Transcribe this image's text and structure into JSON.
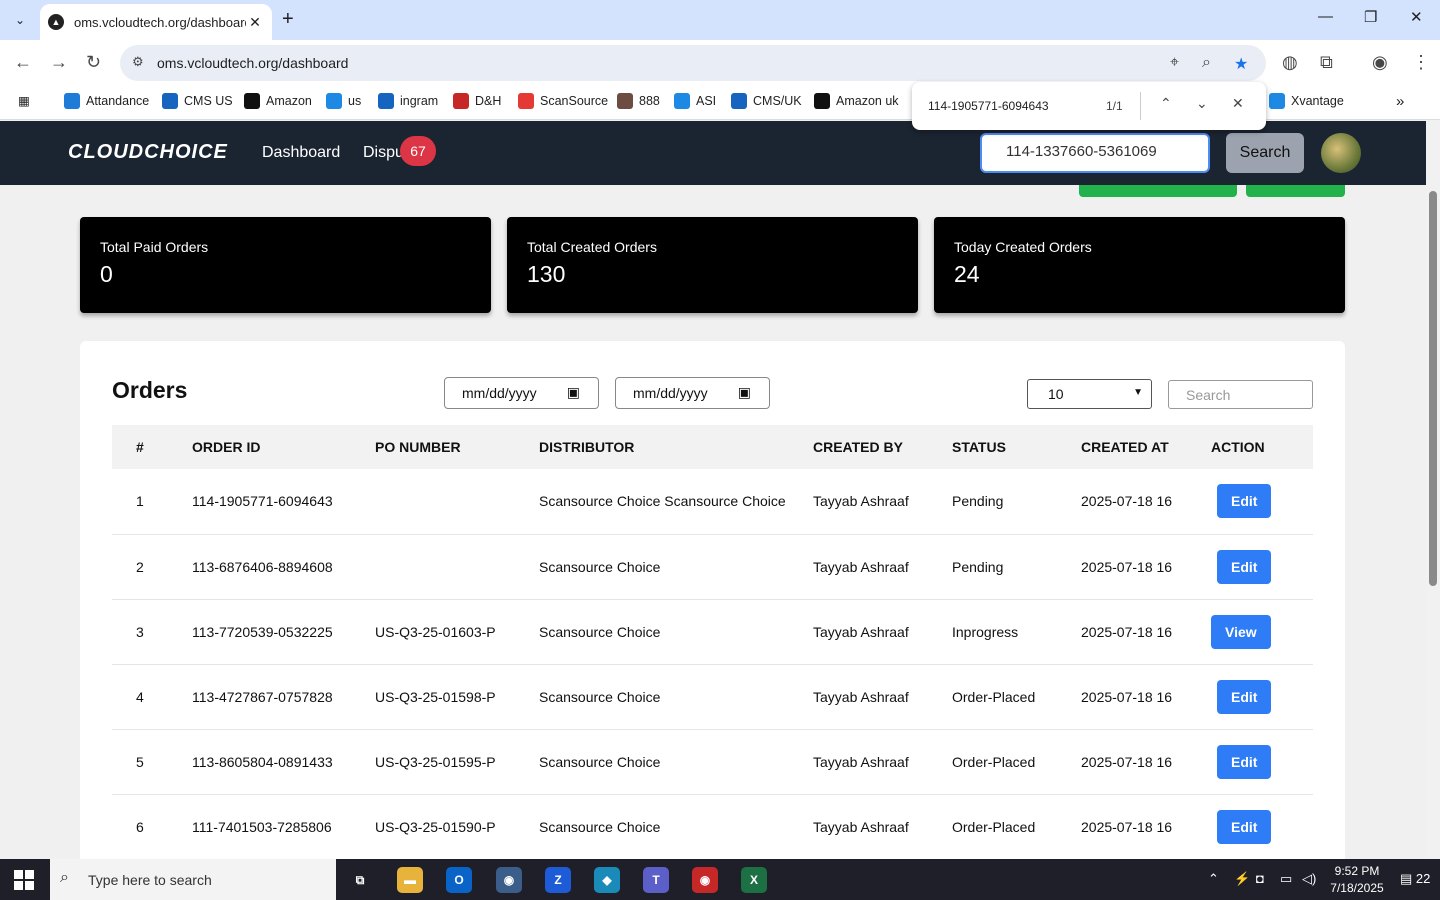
{
  "browser": {
    "tab_title": "oms.vcloudtech.org/dashboard",
    "url": "oms.vcloudtech.org/dashboard",
    "bookmarks": [
      {
        "label": "Attandance",
        "color": "#1f7bd8"
      },
      {
        "label": "CMS US",
        "color": "#1565c0"
      },
      {
        "label": "Amazon",
        "color": "#111111"
      },
      {
        "label": "us",
        "color": "#1e88e5"
      },
      {
        "label": "ingram",
        "color": "#1565c0"
      },
      {
        "label": "D&H",
        "color": "#c62828"
      },
      {
        "label": "ScanSource",
        "color": "#e53935"
      },
      {
        "label": "888",
        "color": "#6d4c41"
      },
      {
        "label": "ASI",
        "color": "#1e88e5"
      },
      {
        "label": "CMS/UK",
        "color": "#1565c0"
      },
      {
        "label": "Amazon uk",
        "color": "#111111"
      },
      {
        "label": "Xvantage",
        "color": "#1e88e5"
      }
    ]
  },
  "findbar": {
    "query": "114-1905771-6094643",
    "count": "1/1"
  },
  "navbar": {
    "logo": "CLOUDCHOICE",
    "links": [
      "Dashboard",
      "Dispu"
    ],
    "badge": "67",
    "search_value": "114-1337660-5361069",
    "search_button": "Search"
  },
  "stats": [
    {
      "label": "Total Paid Orders",
      "value": "0"
    },
    {
      "label": "Total Created Orders",
      "value": "130"
    },
    {
      "label": "Today Created Orders",
      "value": "24"
    }
  ],
  "orders": {
    "title": "Orders",
    "date_placeholder_1": "mm/dd/yyyy",
    "date_placeholder_2": "mm/dd/yyyy",
    "page_size": "10",
    "search_placeholder": "Search",
    "columns": [
      "#",
      "ORDER ID",
      "PO NUMBER",
      "DISTRIBUTOR",
      "CREATED BY",
      "STATUS",
      "CREATED AT",
      "ACTION"
    ],
    "rows": [
      {
        "n": "1",
        "order_id": "114-1905771-6094643",
        "po": "",
        "distributor": "Scansource Choice Scansource Choice",
        "created_by": "Tayyab Ashraaf",
        "status": "Pending",
        "created_at": "2025-07-18 16",
        "action": "Edit"
      },
      {
        "n": "2",
        "order_id": "113-6876406-8894608",
        "po": "",
        "distributor": "Scansource Choice",
        "created_by": "Tayyab Ashraaf",
        "status": "Pending",
        "created_at": "2025-07-18 16",
        "action": "Edit"
      },
      {
        "n": "3",
        "order_id": "113-7720539-0532225",
        "po": "US-Q3-25-01603-P",
        "distributor": "Scansource Choice",
        "created_by": "Tayyab Ashraaf",
        "status": "Inprogress",
        "created_at": "2025-07-18 16",
        "action": "View"
      },
      {
        "n": "4",
        "order_id": "113-4727867-0757828",
        "po": "US-Q3-25-01598-P",
        "distributor": "Scansource Choice",
        "created_by": "Tayyab Ashraaf",
        "status": "Order-Placed",
        "created_at": "2025-07-18 16",
        "action": "Edit"
      },
      {
        "n": "5",
        "order_id": "113-8605804-0891433",
        "po": "US-Q3-25-01595-P",
        "distributor": "Scansource Choice",
        "created_by": "Tayyab Ashraaf",
        "status": "Order-Placed",
        "created_at": "2025-07-18 16",
        "action": "Edit"
      },
      {
        "n": "6",
        "order_id": "111-7401503-7285806",
        "po": "US-Q3-25-01590-P",
        "distributor": "Scansource Choice",
        "created_by": "Tayyab Ashraaf",
        "status": "Order-Placed",
        "created_at": "2025-07-18 16",
        "action": "Edit"
      }
    ]
  },
  "taskbar": {
    "search_text": "Type here to search",
    "time": "9:52 PM",
    "date": "7/18/2025",
    "notifications": "22"
  }
}
